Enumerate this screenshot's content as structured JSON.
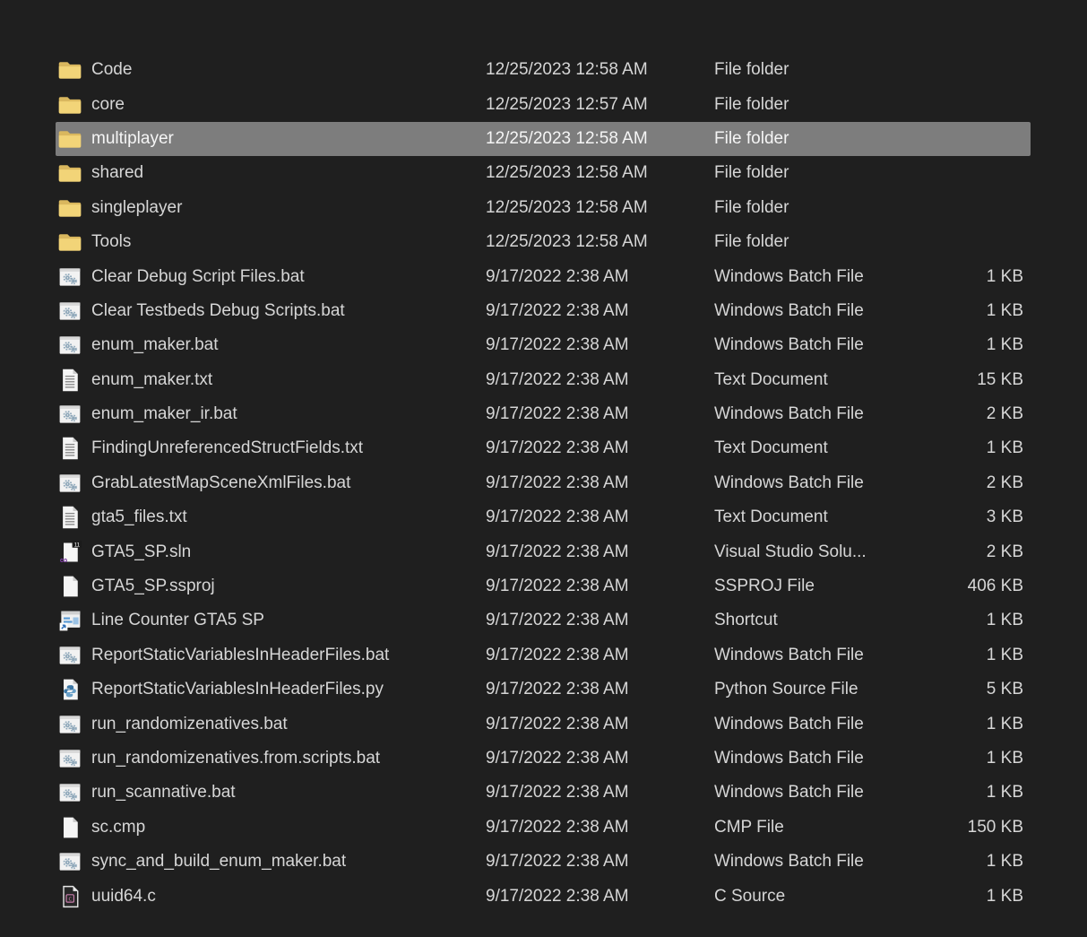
{
  "window": {
    "background_color": "#1f1f1f",
    "selection_color": "#7d7d7d",
    "text_color": "#d6d6d6",
    "folder_color": "#f2d478"
  },
  "file_list": {
    "rows": [
      {
        "name": "Code",
        "icon": "folder-icon",
        "date": "12/25/2023 12:58 AM",
        "type": "File folder",
        "size": "",
        "selected": false
      },
      {
        "name": "core",
        "icon": "folder-icon",
        "date": "12/25/2023 12:57 AM",
        "type": "File folder",
        "size": "",
        "selected": false
      },
      {
        "name": "multiplayer",
        "icon": "folder-icon",
        "date": "12/25/2023 12:58 AM",
        "type": "File folder",
        "size": "",
        "selected": true
      },
      {
        "name": "shared",
        "icon": "folder-icon",
        "date": "12/25/2023 12:58 AM",
        "type": "File folder",
        "size": "",
        "selected": false
      },
      {
        "name": "singleplayer",
        "icon": "folder-icon",
        "date": "12/25/2023 12:58 AM",
        "type": "File folder",
        "size": "",
        "selected": false
      },
      {
        "name": "Tools",
        "icon": "folder-icon",
        "date": "12/25/2023 12:58 AM",
        "type": "File folder",
        "size": "",
        "selected": false
      },
      {
        "name": "Clear Debug Script Files.bat",
        "icon": "batch-file-icon",
        "date": "9/17/2022 2:38 AM",
        "type": "Windows Batch File",
        "size": "1 KB",
        "selected": false
      },
      {
        "name": "Clear Testbeds Debug Scripts.bat",
        "icon": "batch-file-icon",
        "date": "9/17/2022 2:38 AM",
        "type": "Windows Batch File",
        "size": "1 KB",
        "selected": false
      },
      {
        "name": "enum_maker.bat",
        "icon": "batch-file-icon",
        "date": "9/17/2022 2:38 AM",
        "type": "Windows Batch File",
        "size": "1 KB",
        "selected": false
      },
      {
        "name": "enum_maker.txt",
        "icon": "text-document-icon",
        "date": "9/17/2022 2:38 AM",
        "type": "Text Document",
        "size": "15 KB",
        "selected": false
      },
      {
        "name": "enum_maker_ir.bat",
        "icon": "batch-file-icon",
        "date": "9/17/2022 2:38 AM",
        "type": "Windows Batch File",
        "size": "2 KB",
        "selected": false
      },
      {
        "name": "FindingUnreferencedStructFields.txt",
        "icon": "text-document-icon",
        "date": "9/17/2022 2:38 AM",
        "type": "Text Document",
        "size": "1 KB",
        "selected": false
      },
      {
        "name": "GrabLatestMapSceneXmlFiles.bat",
        "icon": "batch-file-icon",
        "date": "9/17/2022 2:38 AM",
        "type": "Windows Batch File",
        "size": "2 KB",
        "selected": false
      },
      {
        "name": "gta5_files.txt",
        "icon": "text-document-icon",
        "date": "9/17/2022 2:38 AM",
        "type": "Text Document",
        "size": "3 KB",
        "selected": false
      },
      {
        "name": "GTA5_SP.sln",
        "icon": "visual-studio-solution-icon",
        "date": "9/17/2022 2:38 AM",
        "type": "Visual Studio Solu...",
        "size": "2 KB",
        "selected": false
      },
      {
        "name": "GTA5_SP.ssproj",
        "icon": "generic-file-icon",
        "date": "9/17/2022 2:38 AM",
        "type": "SSPROJ File",
        "size": "406 KB",
        "selected": false
      },
      {
        "name": "Line Counter GTA5 SP",
        "icon": "shortcut-icon",
        "date": "9/17/2022 2:38 AM",
        "type": "Shortcut",
        "size": "1 KB",
        "selected": false
      },
      {
        "name": "ReportStaticVariablesInHeaderFiles.bat",
        "icon": "batch-file-icon",
        "date": "9/17/2022 2:38 AM",
        "type": "Windows Batch File",
        "size": "1 KB",
        "selected": false
      },
      {
        "name": "ReportStaticVariablesInHeaderFiles.py",
        "icon": "python-icon",
        "date": "9/17/2022 2:38 AM",
        "type": "Python Source File",
        "size": "5 KB",
        "selected": false
      },
      {
        "name": "run_randomizenatives.bat",
        "icon": "batch-file-icon",
        "date": "9/17/2022 2:38 AM",
        "type": "Windows Batch File",
        "size": "1 KB",
        "selected": false
      },
      {
        "name": "run_randomizenatives.from.scripts.bat",
        "icon": "batch-file-icon",
        "date": "9/17/2022 2:38 AM",
        "type": "Windows Batch File",
        "size": "1 KB",
        "selected": false
      },
      {
        "name": "run_scannative.bat",
        "icon": "batch-file-icon",
        "date": "9/17/2022 2:38 AM",
        "type": "Windows Batch File",
        "size": "1 KB",
        "selected": false
      },
      {
        "name": "sc.cmp",
        "icon": "generic-file-icon",
        "date": "9/17/2022 2:38 AM",
        "type": "CMP File",
        "size": "150 KB",
        "selected": false
      },
      {
        "name": "sync_and_build_enum_maker.bat",
        "icon": "batch-file-icon",
        "date": "9/17/2022 2:38 AM",
        "type": "Windows Batch File",
        "size": "1 KB",
        "selected": false
      },
      {
        "name": "uuid64.c",
        "icon": "c-source-icon",
        "date": "9/17/2022 2:38 AM",
        "type": "C Source",
        "size": "1 KB",
        "selected": false
      }
    ]
  }
}
